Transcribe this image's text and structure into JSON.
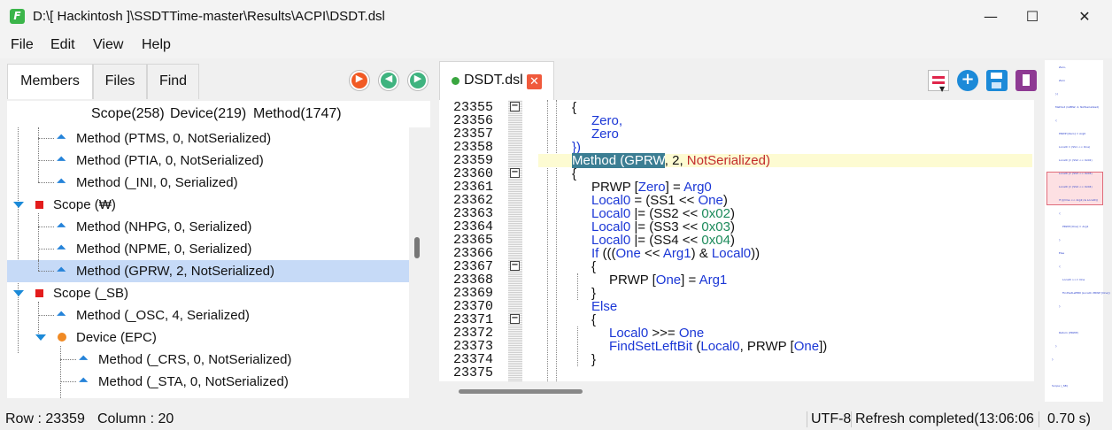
{
  "window": {
    "title": "D:\\[ Hackintosh ]\\SSDTTime-master\\Results\\ACPI\\DSDT.dsl",
    "app_icon": "ssdt-app-icon",
    "minimize": "—",
    "maximize": "☐",
    "close": "✕"
  },
  "menu": [
    "File",
    "Edit",
    "View",
    "Help"
  ],
  "left": {
    "tabs": [
      "Members",
      "Files",
      "Find"
    ],
    "summary": {
      "scope": "Scope(258)",
      "device": "Device(219)",
      "method": "Method(1747)"
    },
    "tree": [
      "Method (PTMS, 0, NotSerialized)",
      "Method (PTIA, 0, NotSerialized)",
      "Method (_INI, 0, Serialized)",
      "Scope (₩)",
      "Method (NHPG, 0, Serialized)",
      "Method (NPME, 0, Serialized)",
      "Method (GPRW, 2, NotSerialized)",
      "Scope (_SB)",
      "Method (_OSC, 4, Serialized)",
      "Device (EPC)",
      "Method (_CRS, 0, NotSerialized)",
      "Method (_STA, 0, NotSerialized)"
    ]
  },
  "editor": {
    "tab_label": "DSDT.dsl",
    "line_numbers": [
      "23355",
      "23356",
      "23357",
      "23358",
      "23359",
      "23360",
      "23361",
      "23362",
      "23363",
      "23364",
      "23365",
      "23366",
      "23367",
      "23368",
      "23369",
      "23370",
      "23371",
      "23372",
      "23373",
      "23374",
      "23375"
    ],
    "code": {
      "brace_open": "{",
      "zero_comma": "Zero,",
      "zero": "Zero",
      "close_paren": "})",
      "method_sel": "Method (GPRW",
      "method_rest_a": ", 2, ",
      "method_rest_b": "NotSerialized",
      "method_rest_c": ")",
      "l1a": "PRWP [",
      "l1b": "Zero",
      "l1c": "] = ",
      "l1d": "Arg0",
      "l2a": "Local0",
      "l2b": " = (SS1 << ",
      "l2c": "One",
      "l2d": ")",
      "l3a": "Local0",
      "l3b": " |= (SS2 << ",
      "l3c": "0x02",
      "l3d": ")",
      "l4a": "Local0",
      "l4b": " |= (SS3 << ",
      "l4c": "0x03",
      "l4d": ")",
      "l5a": "Local0",
      "l5b": " |= (SS4 << ",
      "l5c": "0x04",
      "l5d": ")",
      "l6a": "If",
      "l6b": " (((",
      "l6c": "One",
      "l6d": " << ",
      "l6e": "Arg1",
      "l6f": ") & ",
      "l6g": "Local0",
      "l6h": "))",
      "l7": "{",
      "l8a": "PRWP [",
      "l8b": "One",
      "l8c": "] = ",
      "l8d": "Arg1",
      "l9": "}",
      "l10": "Else",
      "l11": "{",
      "l12a": "Local0",
      "l12b": " >>= ",
      "l12c": "One",
      "l13a": "FindSetLeftBit",
      "l13b": " (",
      "l13c": "Local0",
      "l13d": ", PRWP [",
      "l13e": "One",
      "l13f": "])",
      "l14": "}"
    }
  },
  "minimap": [
    "Zero,",
    "Zero",
    "})",
    "Method (GPRW, 2, NotSerialized)",
    "{",
    "PRWP [Zero] = Arg0",
    "Local0 = (SS1 << One)",
    "Local0 |= (SS2 << 0x02)",
    "Local0 |= (SS3 << 0x03)",
    "Local0 |= (SS4 << 0x04)",
    "If (((One << Arg1) & Local0))",
    "{",
    "PRWP [One] = Arg1",
    "}",
    "Else",
    "{",
    "Local0 >>= One",
    "FindSetLeftBit (Local0, PRWP [One])",
    "}",
    "Return (PRWP)",
    "}",
    "}",
    "Scope (_SB)"
  ],
  "status": {
    "row": "Row : 23359",
    "column": "Column : 20",
    "encoding": "UTF-8",
    "refresh": "Refresh completed(13:06:06",
    "time": "0.70 s)"
  },
  "colors": {
    "accent": "#1c8ad8",
    "selection": "#c6daf7",
    "keyword": "#1b37d6",
    "number": "#1b8a5a",
    "string": "#c22b2b",
    "line_highlight": "#fdfbd2"
  }
}
